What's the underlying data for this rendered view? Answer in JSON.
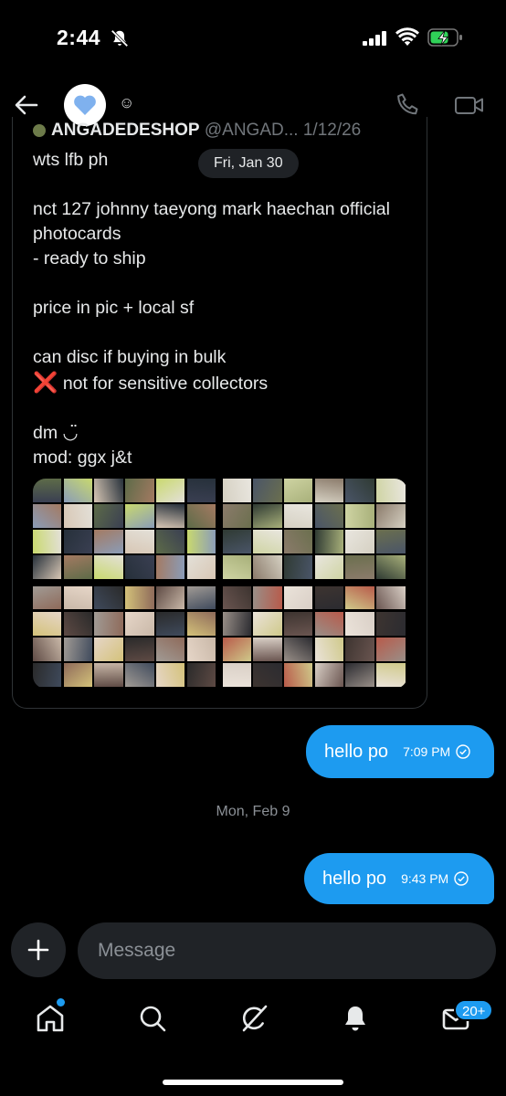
{
  "status_bar": {
    "time": "2:44"
  },
  "header": {
    "emoji": "☺"
  },
  "post": {
    "author_name": "ANGADEDESHOP",
    "author_handle": "@ANGAD...",
    "author_date": "1/12/26",
    "text": "wts lfb ph\n\nnct 127 johnny taeyong mark haechan official photocards\n- ready to ship\n\nprice in pic + local sf\n\ncan disc if buying in bulk",
    "text_cross_line": "not for sensitive collectors",
    "cross_emoji": "❌",
    "text_tail": "\ndm ◡̈\nmod: ggx j&t"
  },
  "date_pill": "Fri, Jan 30",
  "messages": [
    {
      "text": "hello po",
      "time": "7:09 PM"
    },
    {
      "text": "hello po",
      "time": "9:43 PM"
    }
  ],
  "date_divider": "Mon, Feb 9",
  "composer": {
    "placeholder": "Message"
  },
  "nav": {
    "badge": "20+"
  },
  "colors": {
    "accent": "#1d9bf0",
    "background": "#000000",
    "surface": "#202327"
  }
}
